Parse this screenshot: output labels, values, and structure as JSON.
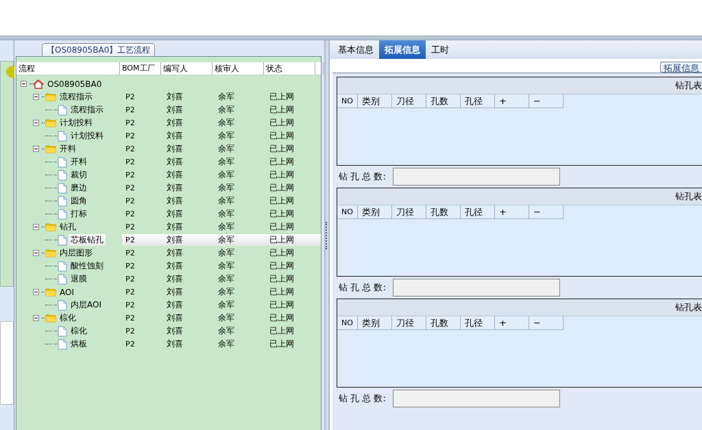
{
  "tree_panel": {
    "title": "【OS08905BA0】工艺流程",
    "columns": [
      "流程",
      "BOM工厂",
      "编写人",
      "核审人",
      "状态"
    ],
    "root": {
      "label": "OS08905BA0",
      "kind": "root",
      "expanded": true,
      "selected": false,
      "children": [
        {
          "label": "流程指示",
          "kind": "folder",
          "expanded": true,
          "selected": false,
          "bom": "P2",
          "author": "刘喜",
          "reviewer": "余军",
          "status": "已上网",
          "children": [
            {
              "label": "流程指示",
              "kind": "file",
              "selected": false,
              "bom": "P2",
              "author": "刘喜",
              "reviewer": "余军",
              "status": "已上网"
            }
          ]
        },
        {
          "label": "计划投料",
          "kind": "folder",
          "expanded": true,
          "selected": false,
          "bom": "P2",
          "author": "刘喜",
          "reviewer": "余军",
          "status": "已上网",
          "children": [
            {
              "label": "计划投料",
              "kind": "file",
              "selected": false,
              "bom": "P2",
              "author": "刘喜",
              "reviewer": "余军",
              "status": "已上网"
            }
          ]
        },
        {
          "label": "开料",
          "kind": "folder",
          "expanded": true,
          "selected": false,
          "bom": "P2",
          "author": "刘喜",
          "reviewer": "余军",
          "status": "已上网",
          "children": [
            {
              "label": "开料",
              "kind": "file",
              "selected": false,
              "bom": "P2",
              "author": "刘喜",
              "reviewer": "余军",
              "status": "已上网"
            },
            {
              "label": "裁切",
              "kind": "file",
              "selected": false,
              "bom": "P2",
              "author": "刘喜",
              "reviewer": "余军",
              "status": "已上网"
            },
            {
              "label": "磨边",
              "kind": "file",
              "selected": false,
              "bom": "P2",
              "author": "刘喜",
              "reviewer": "余军",
              "status": "已上网"
            },
            {
              "label": "圆角",
              "kind": "file",
              "selected": false,
              "bom": "P2",
              "author": "刘喜",
              "reviewer": "余军",
              "status": "已上网"
            },
            {
              "label": "打标",
              "kind": "file",
              "selected": false,
              "bom": "P2",
              "author": "刘喜",
              "reviewer": "余军",
              "status": "已上网"
            }
          ]
        },
        {
          "label": "钻孔",
          "kind": "folder",
          "expanded": true,
          "selected": false,
          "bom": "P2",
          "author": "刘喜",
          "reviewer": "余军",
          "status": "已上网",
          "children": [
            {
              "label": "芯板钻孔",
              "kind": "file",
              "selected": true,
              "bom": "P2",
              "author": "刘喜",
              "reviewer": "余军",
              "status": "已上网"
            }
          ]
        },
        {
          "label": "内层图形",
          "kind": "folder",
          "expanded": true,
          "selected": false,
          "bom": "P2",
          "author": "刘喜",
          "reviewer": "余军",
          "status": "已上网",
          "children": [
            {
              "label": "酸性蚀刻",
              "kind": "file",
              "selected": false,
              "bom": "P2",
              "author": "刘喜",
              "reviewer": "余军",
              "status": "已上网"
            },
            {
              "label": "退膜",
              "kind": "file",
              "selected": false,
              "bom": "P2",
              "author": "刘喜",
              "reviewer": "余军",
              "status": "已上网"
            }
          ]
        },
        {
          "label": "AOI",
          "kind": "folder",
          "expanded": true,
          "selected": false,
          "bom": "P2",
          "author": "刘喜",
          "reviewer": "余军",
          "status": "已上网",
          "children": [
            {
              "label": "内层AOI",
              "kind": "file",
              "selected": false,
              "bom": "P2",
              "author": "刘喜",
              "reviewer": "余军",
              "status": "已上网"
            }
          ]
        },
        {
          "label": "棕化",
          "kind": "folder",
          "expanded": true,
          "selected": false,
          "bom": "P2",
          "author": "刘喜",
          "reviewer": "余军",
          "status": "已上网",
          "children": [
            {
              "label": "棕化",
              "kind": "file",
              "selected": false,
              "bom": "P2",
              "author": "刘喜",
              "reviewer": "余军",
              "status": "已上网"
            },
            {
              "label": "烘板",
              "kind": "file",
              "selected": false,
              "bom": "P2",
              "author": "刘喜",
              "reviewer": "余军",
              "status": "已上网"
            }
          ]
        }
      ]
    }
  },
  "detail_panel": {
    "tabs": [
      {
        "label": "基本信息",
        "selected": false
      },
      {
        "label": "拓展信息",
        "selected": true
      },
      {
        "label": "工时",
        "selected": false
      }
    ],
    "group_title": "拓展信息",
    "sections": [
      {
        "title": "钻孔表",
        "columns": [
          "NO",
          "类别",
          "刀径",
          "孔数",
          "孔径",
          "+",
          "−"
        ],
        "total_label": "钻 孔 总 数:"
      },
      {
        "title": "钻孔表",
        "columns": [
          "NO",
          "类别",
          "刀径",
          "孔数",
          "孔径",
          "+",
          "−"
        ],
        "total_label": "钻 孔 总 数:"
      },
      {
        "title": "钻孔表",
        "columns": [
          "NO",
          "类别",
          "刀径",
          "孔数",
          "孔径",
          "+",
          "−"
        ],
        "total_label": "钻 孔 总 数:"
      }
    ]
  }
}
